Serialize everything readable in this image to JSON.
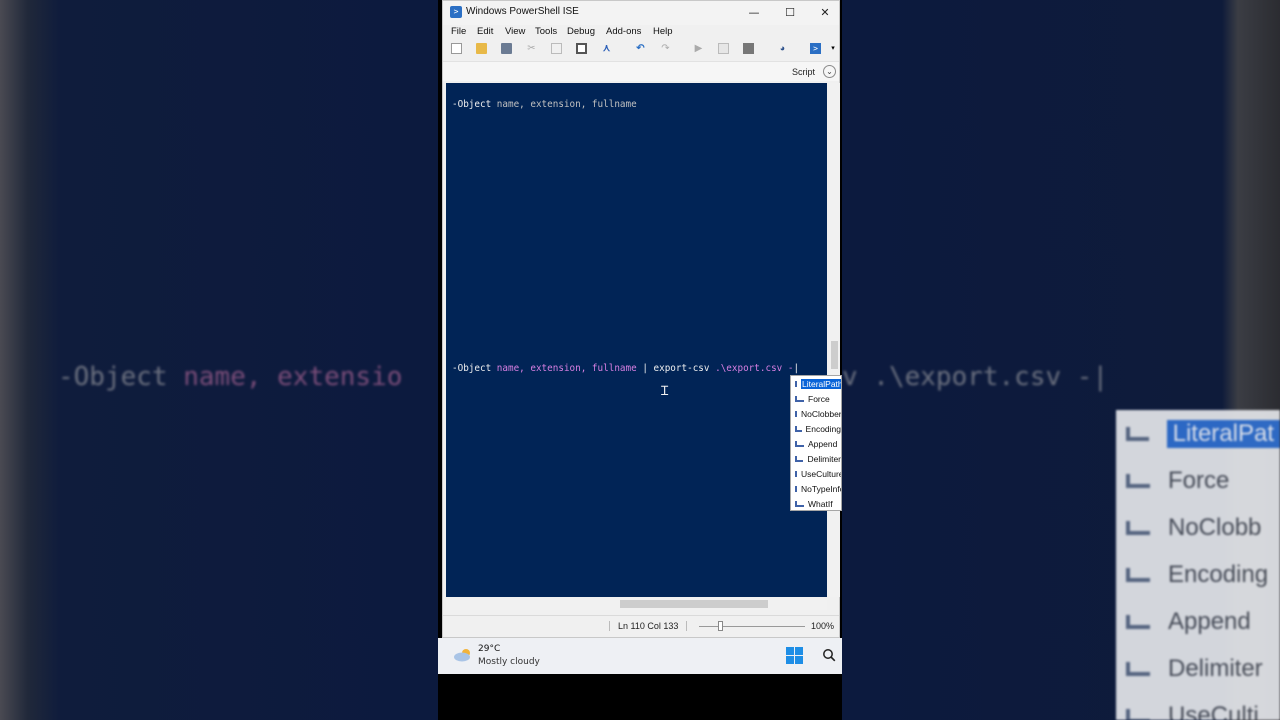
{
  "background": {
    "left_code_prefix": "-Object ",
    "left_code_pink": "name, extensio",
    "right_code": "v .\\export.csv -|",
    "menu_items": [
      "LiteralPat",
      "Force",
      "NoClobb",
      "Encoding",
      "Append",
      "Delimiter",
      "UseCulti"
    ]
  },
  "window": {
    "title": "Windows PowerShell ISE",
    "buttons": {
      "minimize": "—",
      "maximize": "☐",
      "close": "✕"
    }
  },
  "menu": [
    "File",
    "Edit",
    "View",
    "Tools",
    "Debug",
    "Add-ons",
    "Help"
  ],
  "toolbar_icons": [
    "new-icon",
    "open-icon",
    "save-icon",
    "cut-icon",
    "copy-icon",
    "paste-icon",
    "clear-icon",
    "undo-icon",
    "redo-icon",
    "run-icon",
    "run-selection-icon",
    "stop-icon",
    "remote-icon",
    "console-icon"
  ],
  "script_pane": {
    "label": "Script",
    "toggle": "⌄"
  },
  "editor": {
    "line1": {
      "prefix": "-Object ",
      "params": "name, extension, fullname"
    },
    "line2": {
      "prefix": "-Object ",
      "params": "name, extension, fullname",
      "pipe": " | ",
      "cmdlet": "export-csv ",
      "path": ".\\export.csv ",
      "dash": "-",
      "cursor": "|"
    }
  },
  "autocomplete": {
    "items": [
      "LiteralPath",
      "Force",
      "NoClobber",
      "Encoding",
      "Append",
      "Delimiter",
      "UseCulture",
      "NoTypeInformation",
      "WhatIf"
    ],
    "selected": "LiteralPath"
  },
  "status": {
    "position": "Ln 110  Col 133",
    "zoom": "100%"
  },
  "taskbar": {
    "temperature": "29°C",
    "condition": "Mostly cloudy"
  },
  "colors": {
    "editor_bg": "#012456",
    "param_color": "#d77fe1",
    "selection": "#0a64d8"
  }
}
